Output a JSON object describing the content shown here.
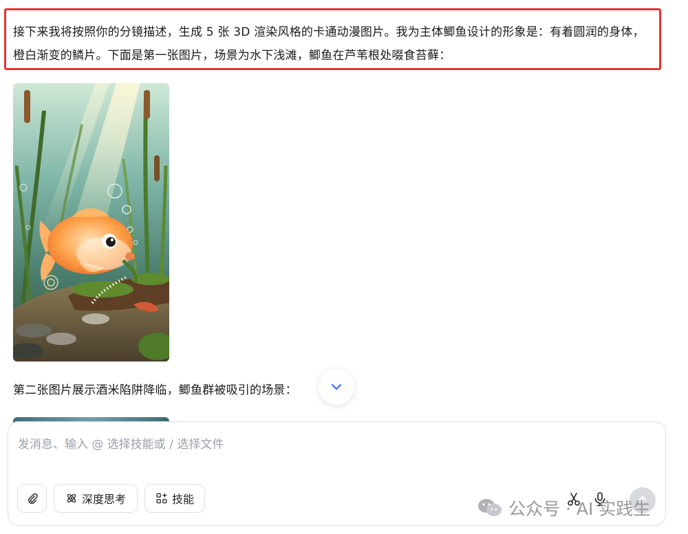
{
  "messages": {
    "intro_text": "接下来我将按照你的分镜描述，生成 5 张 3D 渲染风格的卡通动漫图片。我为主体鲫鱼设计的形象是：有着圆润的身体，橙白渐变的鳞片。下面是第一张图片，场景为水下浅滩，鲫鱼在芦苇根处啜食苔藓：",
    "second_text": "第二张图片展示酒米陷阱降临，鲫鱼群被吸引的场景："
  },
  "composer": {
    "placeholder": "发消息、输入 @ 选择技能或 / 选择文件",
    "think_label": "深度思考",
    "skill_label": "技能"
  },
  "watermark": {
    "text": "公众号 · AI 实践生"
  },
  "icons": {
    "attach": "paperclip-icon",
    "think": "atom-icon",
    "skill": "grid-plus-icon",
    "scissors": "scissors-icon",
    "mic": "microphone-icon",
    "send": "arrow-up-icon",
    "scroll": "chevron-down-icon",
    "wechat": "wechat-icon"
  },
  "colors": {
    "highlight": "#e8312f",
    "accent": "#3a6df0"
  }
}
